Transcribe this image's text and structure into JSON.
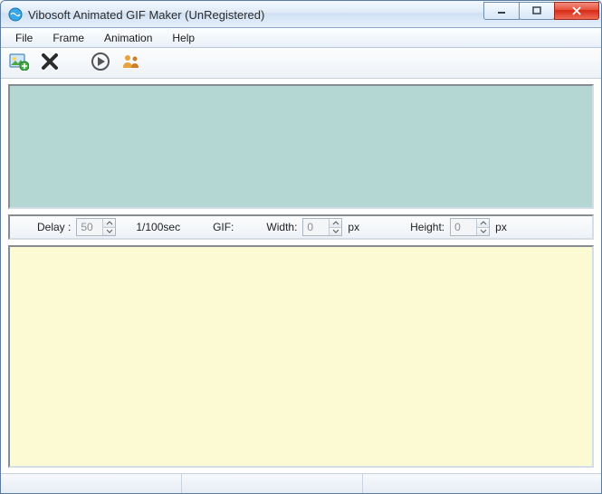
{
  "window": {
    "title": "Vibosoft Animated GIF Maker (UnRegistered)"
  },
  "menus": {
    "file": "File",
    "frame": "Frame",
    "animation": "Animation",
    "help": "Help"
  },
  "toolbar_icons": {
    "add": "add-image-icon",
    "delete": "delete-icon",
    "play": "play-icon",
    "people": "people-icon"
  },
  "params": {
    "delay_label": "Delay :",
    "delay_value": "50",
    "delay_unit": "1/100sec",
    "gif_label": "GIF:",
    "width_label": "Width:",
    "width_value": "0",
    "width_unit": "px",
    "height_label": "Height:",
    "height_value": "0",
    "height_unit": "px"
  },
  "colors": {
    "frames_bg": "#b4d7d4",
    "preview_bg": "#fcfad2",
    "close_red": "#d62a17"
  }
}
